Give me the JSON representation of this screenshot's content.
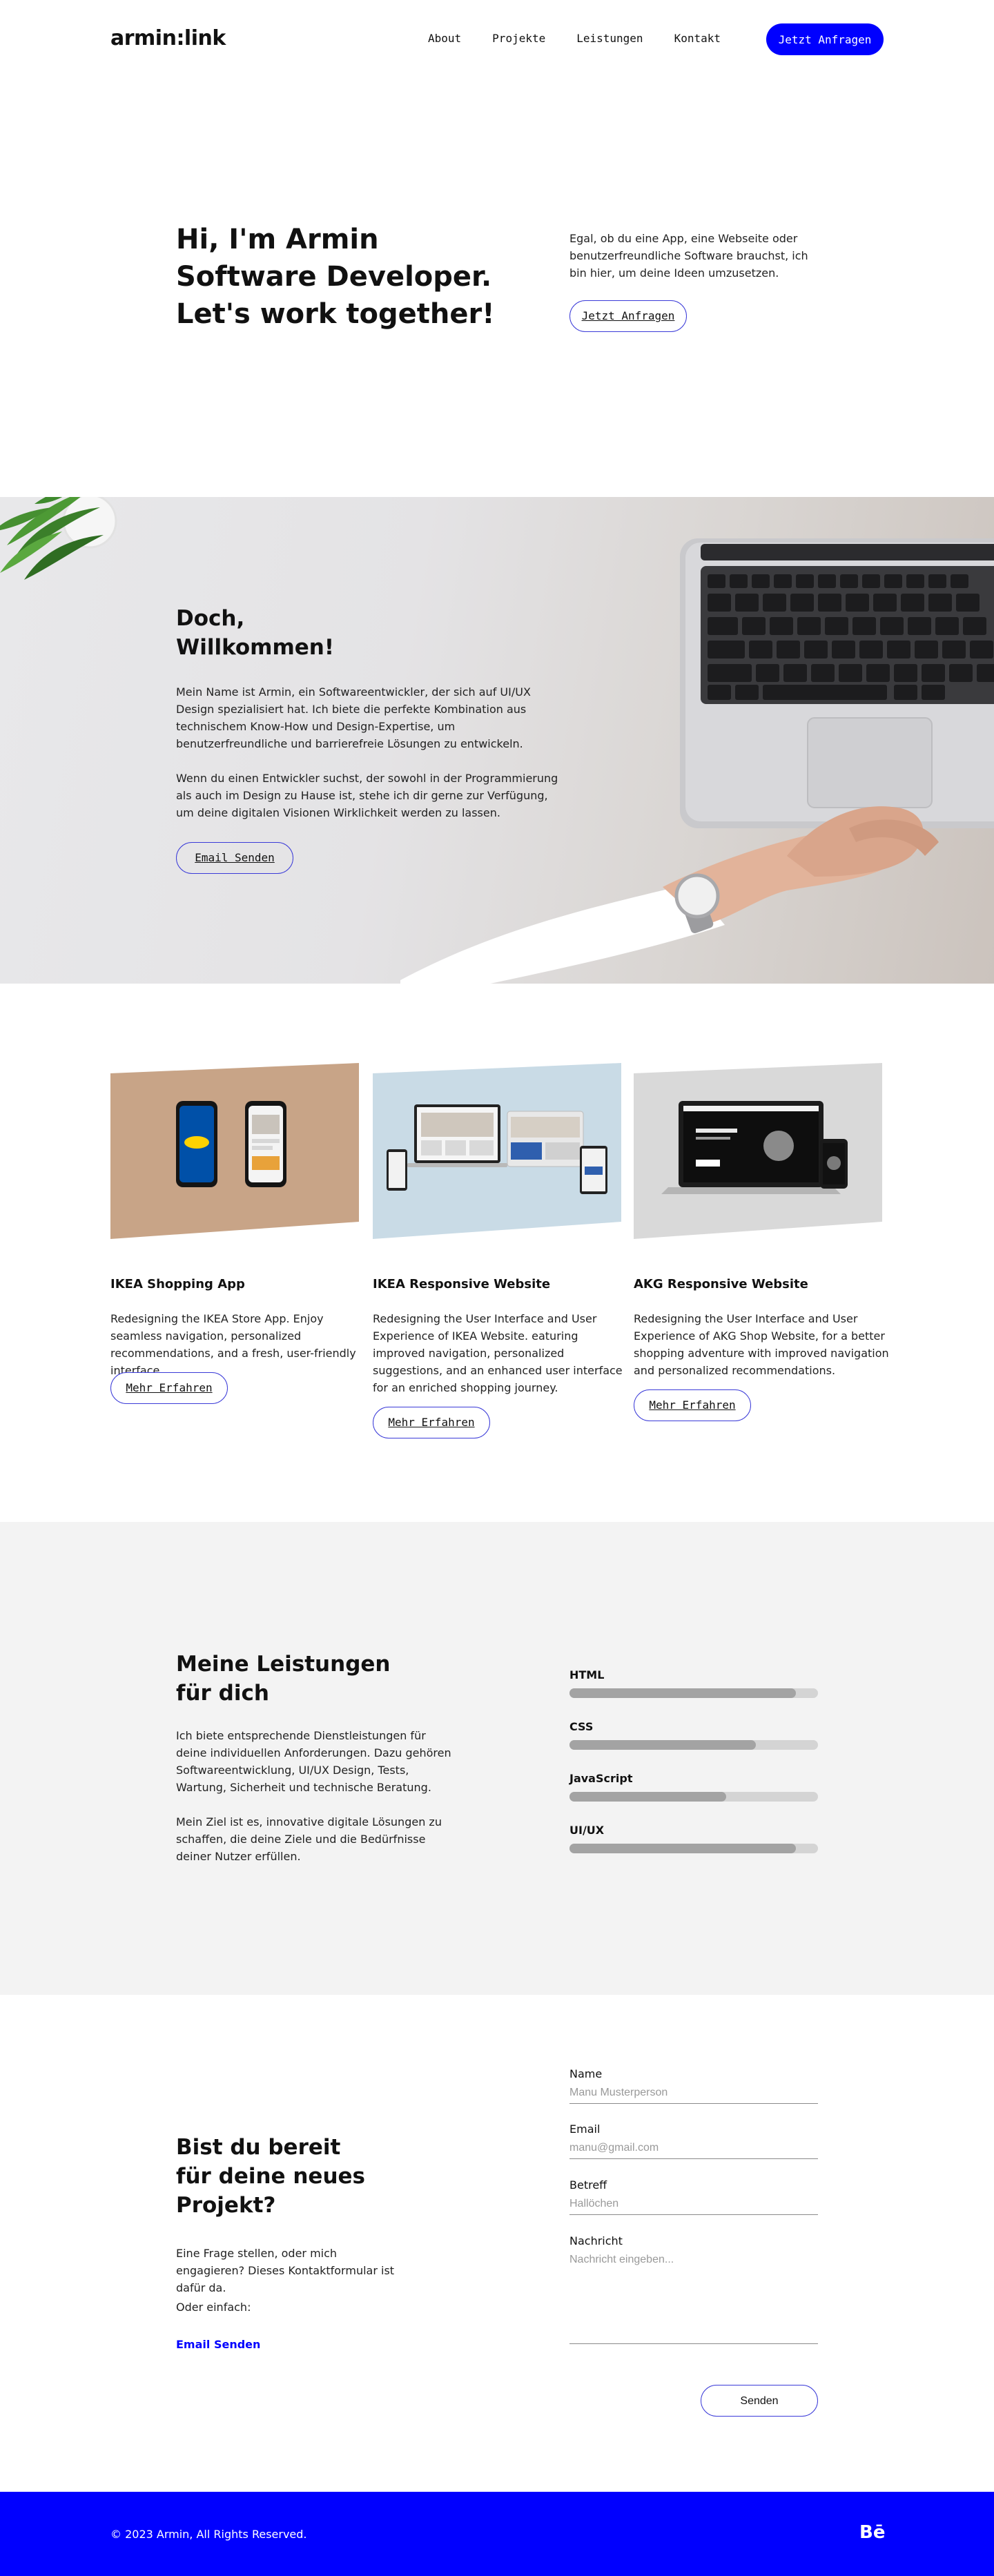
{
  "nav": {
    "logo": "armin:link",
    "links": [
      "About",
      "Projekte",
      "Leistungen",
      "Kontakt"
    ],
    "cta": "Jetzt Anfragen"
  },
  "hero": {
    "title_lines": [
      "Hi, I'm Armin",
      "Software Developer.",
      "Let's work together!"
    ],
    "text": "Egal, ob du eine App, eine Webseite oder benutzerfreundliche Software brauchst, ich bin hier, um deine Ideen umzusetzen.",
    "button": "Jetzt Anfragen"
  },
  "welcome": {
    "title_lines": [
      "Doch,",
      "Willkommen!"
    ],
    "p1": "Mein Name ist Armin, ein Softwareentwickler, der sich auf UI/UX Design spezialisiert hat. Ich biete die perfekte Kombination aus technischem Know-How und Design-Expertise, um benutzerfreundliche und barrierefreie Lösungen zu entwickeln.",
    "p2": "Wenn du einen Entwickler suchst, der sowohl in der Programmierung als auch im Design zu Hause ist, stehe ich dir gerne zur Verfügung, um deine digitalen Visionen Wirklichkeit werden zu lassen.",
    "button": "Email Senden"
  },
  "projects": [
    {
      "title": "IKEA Shopping App",
      "desc": "Redesigning the IKEA Store App. Enjoy seamless navigation, personalized recommendations, and a fresh, user-friendly interface.",
      "button": "Mehr Erfahren",
      "bg": "#c8a487"
    },
    {
      "title": "IKEA Responsive Website",
      "desc": "Redesigning the User Interface and User Experience of IKEA Website. eaturing improved navigation, personalized suggestions, and an enhanced user interface for an enriched shopping journey.",
      "button": "Mehr Erfahren",
      "bg": "#c9dbe6"
    },
    {
      "title": "AKG Responsive Website",
      "desc": "Redesigning the User Interface and User Experience of AKG Shop Website, for a better shopping adventure with improved navigation and personalized recommendations.",
      "button": "Mehr Erfahren",
      "bg": "#d9d9d9"
    }
  ],
  "skills": {
    "title_lines": [
      "Meine Leistungen",
      "für dich"
    ],
    "p1": "Ich biete entsprechende Dienstleistungen für deine individuellen Anforderungen. Dazu gehören Softwareentwicklung, UI/UX Design, Tests, Wartung, Sicherheit und technische Beratung.",
    "p2": "Mein Ziel ist es, innovative digitale Lösungen zu schaffen, die deine Ziele und die Bedürfnisse deiner Nutzer erfüllen.",
    "items": [
      {
        "name": "HTML",
        "level": 0.91
      },
      {
        "name": "CSS",
        "level": 0.75
      },
      {
        "name": "JavaScript",
        "level": 0.63
      },
      {
        "name": "UI/UX",
        "level": 0.91
      }
    ]
  },
  "contact": {
    "title_lines": [
      "Bist du bereit",
      "für deine neues",
      "Projekt?"
    ],
    "text": "Eine Frage stellen, oder mich engagieren? Dieses Kontaktformular ist dafür da.",
    "or": "Oder einfach:",
    "email_link": "Email Senden",
    "fields": {
      "name_label": "Name",
      "name_placeholder": "Manu Musterperson",
      "email_label": "Email",
      "email_placeholder": "manu@gmail.com",
      "subject_label": "Betreff",
      "subject_placeholder": "Hallöchen",
      "message_label": "Nachricht",
      "message_placeholder": "Nachricht eingeben..."
    },
    "send": "Senden"
  },
  "footer": {
    "copyright": "© 2023 Armin, All Rights Reserved.",
    "social": "Bē"
  },
  "colors": {
    "accent": "#0000ff",
    "section_gray": "#f3f3f3"
  }
}
